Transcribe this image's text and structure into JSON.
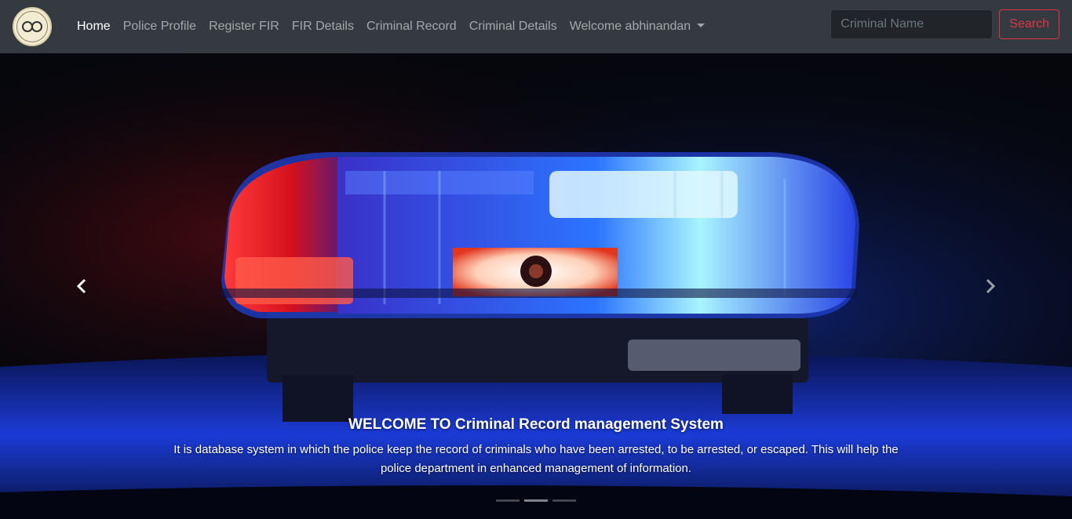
{
  "nav": {
    "logo_icon": "handcuffs-emblem-icon",
    "links": [
      {
        "label": "Home",
        "active": true
      },
      {
        "label": "Police Profile",
        "active": false
      },
      {
        "label": "Register FIR",
        "active": false
      },
      {
        "label": "FIR Details",
        "active": false
      },
      {
        "label": "Criminal Record",
        "active": false
      },
      {
        "label": "Criminal Details",
        "active": false
      }
    ],
    "user_dropdown": "Welcome abhinandan",
    "search_placeholder": "Criminal Name",
    "search_button": "Search"
  },
  "carousel": {
    "caption_title": "WELCOME TO Criminal Record management System",
    "caption_text": "It is database system in which the police keep the record of criminals who have been arrested, to be arrested, or escaped. This will help the police department in enhanced management of information.",
    "prev_icon": "chevron-left-icon",
    "next_icon": "chevron-right-icon",
    "slide_count": 3,
    "active_slide": 1
  },
  "colors": {
    "navbar_bg": "#343a40",
    "search_btn": "#dc3545",
    "siren_red": "#ff2233",
    "siren_blue": "#2a5cff"
  }
}
